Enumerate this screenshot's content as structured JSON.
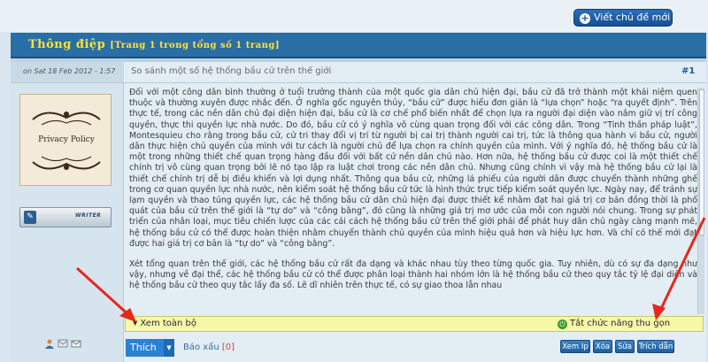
{
  "toolbar": {
    "new_topic_label": "Viết chủ đề mới"
  },
  "header": {
    "title_main": "Thông điệp",
    "title_page": "[Trang 1 trong tổng số 1 trang]"
  },
  "post": {
    "date": "on Sat 18 Feb 2012 - 1:57",
    "subject": "So sánh một số hệ thống bầu cử trên thế giới",
    "number": "#1",
    "paragraph1": "Đối với một công dân bình thường ở tuổi trưởng thành của một quốc gia dân chủ hiện đại, bầu cử đã trở thành một khái niệm quen thuộc và thường xuyên được nhắc đến. Ở nghĩa gốc nguyên thủy, “bầu cử” được hiểu đơn giản là “lựa chọn” hoặc “ra quyết định”. Trên thực tế, trong các nền dân chủ đại diện hiện đại, bầu cử là cơ chế phổ biến nhất để chọn lựa ra người đại diện vào nắm giữ vị trí công quyền, thực thi quyền lực nhà nước. Do đó, bầu cử có ý nghĩa vô cùng quan trọng đối với các công dân. Trong “Tinh thần pháp luật”, Montesquieu cho rằng trong bầu cử, cử tri thay đổi vị trí từ người bị cai trị thành người cai trị, tức là thông qua hành vi bầu cử, người dân thực hiện chủ quyền của mình với tư cách là người chủ để lựa chọn ra chính quyền của mình. Với ý nghĩa đó, hệ thống bầu cử là một trong những thiết chế quan trọng hàng đầu đối với bất cứ nền dân chủ nào. Hơn nữa, hệ thống bầu cử được coi là một thiết chế chính trị vô cùng quan trọng bởi lẽ nó tạo lập ra luật chơi trong các nền dân chủ. Nhưng cũng chính vì vậy mà hệ thống bầu cử lại là thiết chế chính trị dễ bị điều khiển và lợi dụng nhất. Thông qua bầu cử, những lá phiếu của người dân được chuyển thành những ghế trong cơ quan quyền lực nhà nước, nên kiểm soát hệ thống bầu cử tức là hình thức trực tiếp kiểm soát quyền lực. Ngày nay, để tránh sự lạm quyền và thao túng quyền lực, các hệ thống bầu cử dân chủ hiện đại được thiết kế nhằm đạt hai giá trị cơ bản đồng thời là phổ quát của bầu cử trên thế giới là “tự do” và “công bằng”, đó cũng là những giá trị mơ ước của mỗi con người nói chung. Trong sự phát triển của nhân loại, mục tiêu chiến lược của các cải cách hệ thống bầu cử trên thế giới phải để phát huy dân chủ ngày càng mạnh mẽ, hệ thống bầu cử có thể được hoàn thiện nhằm chuyển thành chủ quyền của mình hiệu quả hơn và hiệu lực hơn. Và chỉ có thế mới đạt được hai giá trị cơ bản là “tự do” và “công bằng”.",
    "paragraph2": "Xét tổng quan trên thế giới, các hệ thống bầu cử rất đa dạng và khác nhau tùy theo từng quốc gia. Tuy nhiên, dù có sự đa dạng như vậy, nhưng về đại thể, các hệ thống bầu cử có thể được phân loại thành hai nhóm lớn là hệ thống bầu cử theo quy tắc tỷ lệ đại diện và hệ thống bầu cử theo quy tắc lấy đa số. Lẽ dĩ nhiên trên thực tế, có sự giao thoa lẫn nhau"
  },
  "author": {
    "avatar_text": "Privacy Policy",
    "rank_label": "WRITER"
  },
  "toggle": {
    "expand_label": "Xem toàn bộ",
    "disable_label": "Tắt chức năng thu gọn"
  },
  "footer": {
    "like_label": "Thích",
    "dislike_label": "Báo xấu",
    "dislike_count": "[0]",
    "buttons": [
      "Xem Ip",
      "Xóa",
      "Sửa",
      "Trích dẫn"
    ]
  }
}
